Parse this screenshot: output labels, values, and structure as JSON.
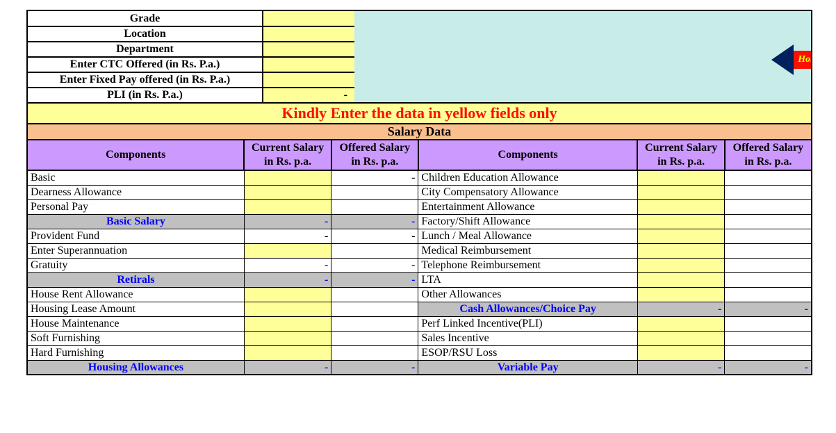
{
  "top": {
    "grade_label": "Grade",
    "grade_value": "",
    "location_label": "Location",
    "location_value": "",
    "department_label": "Department",
    "department_value": "",
    "ctc_label": "Enter CTC Offered (in Rs. P.a.)",
    "ctc_value": "",
    "fixed_pay_label": "Enter Fixed Pay offered (in Rs. P.a.)",
    "fixed_pay_value": "",
    "pli_label": "PLI (in Rs. P.a.)",
    "pli_value": "-"
  },
  "home_label": "Hom",
  "instruction": "Kindly Enter the data in yellow fields only",
  "salary_data_label": "Salary Data",
  "headers": {
    "components": "Components",
    "current": "Current Salary in Rs. p.a.",
    "offered": "Offered Salary in Rs. p.a."
  },
  "left_rows": [
    {
      "label": "Basic",
      "cur": "",
      "off": "-",
      "type": "row",
      "cur_yellow": true
    },
    {
      "label": "Dearness Allowance",
      "cur": "",
      "off": "",
      "type": "row",
      "cur_yellow": true
    },
    {
      "label": "Personal Pay",
      "cur": "",
      "off": "",
      "type": "row",
      "cur_yellow": true
    },
    {
      "label": "Basic Salary",
      "cur": "-",
      "off": "-",
      "type": "subtotal"
    },
    {
      "label": "Provident Fund",
      "cur": "-",
      "off": "-",
      "type": "row"
    },
    {
      "label": "Enter Superannuation",
      "cur": "",
      "off": "",
      "type": "row",
      "cur_yellow": true
    },
    {
      "label": "Gratuity",
      "cur": "-",
      "off": "-",
      "type": "row"
    },
    {
      "label": "Retirals",
      "cur": "-",
      "off": "-",
      "type": "subtotal"
    },
    {
      "label": "House Rent Allowance",
      "cur": "",
      "off": "",
      "type": "row",
      "cur_yellow": true
    },
    {
      "label": "Housing Lease Amount",
      "cur": "",
      "off": "",
      "type": "row",
      "cur_yellow": true
    },
    {
      "label": "House Maintenance",
      "cur": "",
      "off": "",
      "type": "row",
      "cur_yellow": true
    },
    {
      "label": "Soft Furnishing",
      "cur": "",
      "off": "",
      "type": "row",
      "cur_yellow": true
    },
    {
      "label": "Hard Furnishing",
      "cur": "",
      "off": "",
      "type": "row",
      "cur_yellow": true
    },
    {
      "label": "Housing Allowances",
      "cur": "-",
      "off": "-",
      "type": "subtotal"
    }
  ],
  "right_rows": [
    {
      "label": "Children Education Allowance",
      "cur": "",
      "off": "",
      "type": "row",
      "cur_yellow": true
    },
    {
      "label": "City Compensatory Allowance",
      "cur": "",
      "off": "",
      "type": "row",
      "cur_yellow": true
    },
    {
      "label": "Entertainment Allowance",
      "cur": "",
      "off": "",
      "type": "row",
      "cur_yellow": true
    },
    {
      "label": "Factory/Shift Allowance",
      "cur": "",
      "off": "",
      "type": "row",
      "cur_yellow": true
    },
    {
      "label": "Lunch / Meal Allowance",
      "cur": "",
      "off": "",
      "type": "row",
      "cur_yellow": true
    },
    {
      "label": "Medical Reimbursement",
      "cur": "",
      "off": "",
      "type": "row",
      "cur_yellow": true
    },
    {
      "label": "Telephone Reimbursement",
      "cur": "",
      "off": "",
      "type": "row",
      "cur_yellow": true
    },
    {
      "label": "LTA",
      "cur": "",
      "off": "",
      "type": "row",
      "cur_yellow": true
    },
    {
      "label": "Other Allowances",
      "cur": "",
      "off": "",
      "type": "row",
      "cur_yellow": true
    },
    {
      "label": "Cash Allowances/Choice Pay",
      "cur": "-",
      "off": "-",
      "type": "subtotal"
    },
    {
      "label": "Perf Linked Incentive(PLI)",
      "cur": "",
      "off": "",
      "type": "row",
      "cur_yellow": true
    },
    {
      "label": "Sales Incentive",
      "cur": "",
      "off": "",
      "type": "row",
      "cur_yellow": true
    },
    {
      "label": "ESOP/RSU Loss",
      "cur": "",
      "off": "",
      "type": "row",
      "cur_yellow": true
    },
    {
      "label": "Variable Pay",
      "cur": "-",
      "off": "-",
      "type": "subtotal"
    }
  ]
}
